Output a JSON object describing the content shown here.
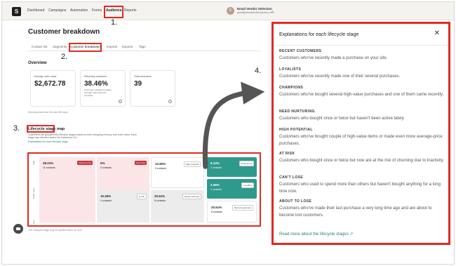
{
  "nav": {
    "items": [
      "Dashboard",
      "Campaigns",
      "Automation",
      "Forms",
      "Audience",
      "Reports"
    ],
    "active": "Audience",
    "user_initials": "E",
    "user_name": "Email Vendor Selection",
    "user_email": "guest@emailvendorselection.com"
  },
  "page": {
    "title": "Customer breakdown",
    "tabs": [
      "Contact list",
      "Segments",
      "Customer breakdown",
      "Imports",
      "Exports",
      "Tags"
    ],
    "active_tab": "Customer breakdown",
    "overview_title": "Overview"
  },
  "cards": [
    {
      "label": "Average order value",
      "value": "$2,672.78",
      "sub": ""
    },
    {
      "label": "Returning customers",
      "value": "38.46%",
      "sub": "Customers usually buy again 103 days after their first purchase."
    },
    {
      "label": "Total customers",
      "value": "39",
      "sub": ""
    }
  ],
  "data_note": "Showing data from the last 365 days",
  "lifecycle": {
    "title": "Lifecycle stage map",
    "description": "Customers are grouped into lifecycle stages based on their shopping recency and order value. Each stage has retention tactics for customers in it.",
    "link": "Explanations for each lifecycle stage",
    "axis_high": "High",
    "axis_mid": "Order value",
    "axis_low": "Low",
    "footnote": "The Lifecycle stage map is updated twice an hour",
    "cells": [
      {
        "pct": "28.21%",
        "count": "11 contacts",
        "tag": "Almost at risk"
      },
      {
        "pct": "0%",
        "count": "0 contacts",
        "tag": "Can't lose"
      },
      {
        "pct": "12.82%",
        "count": "5 contacts",
        "tag": "High potential"
      },
      {
        "pct": "5.13%",
        "count": "2 contacts",
        "tag": "Champions"
      },
      {
        "pct": "2.56%",
        "count": "1 contacts",
        "tag": "Loyalists"
      },
      {
        "pct": "10.26%",
        "count": "4 contacts",
        "tag": "At risk"
      },
      {
        "pct": "20.51%",
        "count": "8 contacts",
        "tag": "Needs nurturing"
      },
      {
        "pct": "20.51%",
        "count": "8 contacts",
        "tag": "Recent customers"
      }
    ]
  },
  "drawer": {
    "title": "Explanations for each lifecycle stage",
    "close_icon": "close-icon",
    "entries": [
      {
        "head": "RECENT CUSTOMERS",
        "desc": "Customers who've recently made a purchase on your site."
      },
      {
        "head": "LOYALISTS",
        "desc": "Customers who've recently made one of their several purchases."
      },
      {
        "head": "CHAMPIONS",
        "desc": "Customers who've bought several high-value purchases and one of them came recently."
      },
      {
        "head": "NEED NURTURING",
        "desc": "Customers who bought once or twice but haven't been active lately."
      },
      {
        "head": "HIGH POTENTIAL",
        "desc": "Customers who've bought couple of high-value items or made even more average-price purchases."
      },
      {
        "head": "AT RISK",
        "desc": "Customers who bought once or twice but now are at the risk of churning due to inactivity."
      },
      {
        "head": "CAN'T LOSE",
        "desc": "Customers who used to spend more than others but haven't bought anything for a long time now."
      },
      {
        "head": "ABOUT TO LOSE",
        "desc": "Customers who've made their last purchase a very long time ago and are about to become lost customers."
      }
    ],
    "link": "Read more about the lifecycle stages ↗"
  },
  "annotations": [
    "1.",
    "2.",
    "3.",
    "4."
  ],
  "colors": {
    "highlight": "#e02a20",
    "teal": "#2e9a8c",
    "pink": "#fbe5e7"
  }
}
